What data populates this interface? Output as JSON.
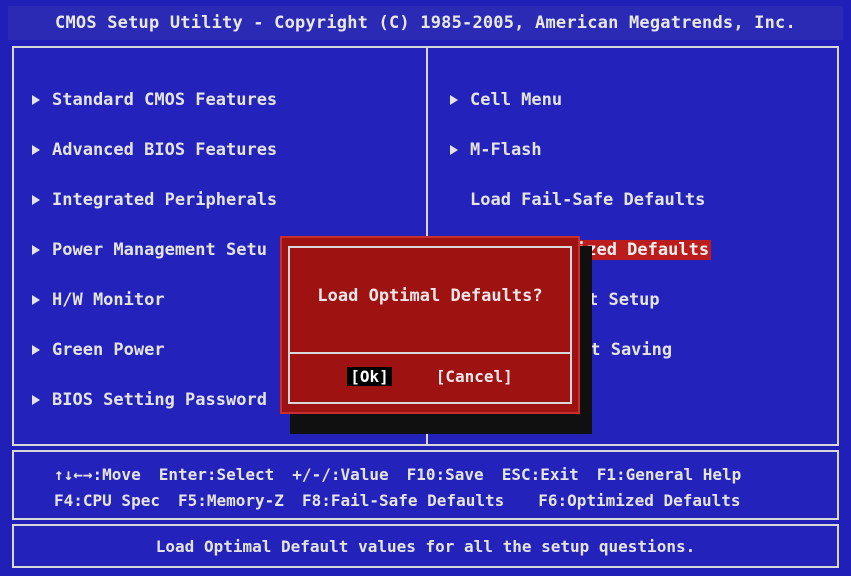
{
  "title": "CMOS Setup Utility - Copyright (C) 1985-2005, American Megatrends, Inc.",
  "left_menu": [
    {
      "label": "Standard CMOS Features"
    },
    {
      "label": "Advanced BIOS Features"
    },
    {
      "label": "Integrated Peripherals"
    },
    {
      "label": "Power Management Setu"
    },
    {
      "label": "H/W Monitor"
    },
    {
      "label": "Green Power"
    },
    {
      "label": "BIOS Setting Password"
    }
  ],
  "right_menu": [
    {
      "label": "Cell Menu"
    },
    {
      "label": "M-Flash"
    },
    {
      "label": "Load Fail-Safe Defaults"
    },
    {
      "label": "ized Defaults"
    },
    {
      "label": "t Setup"
    },
    {
      "label": "ut Saving"
    }
  ],
  "help": {
    "line1": [
      "↑↓←→:Move",
      "Enter:Select",
      "+/-/:Value",
      "F10:Save",
      "ESC:Exit",
      "F1:General Help"
    ],
    "line2": [
      "F4:CPU Spec",
      "F5:Memory-Z",
      "F8:Fail-Safe Defaults",
      "F6:Optimized Defaults"
    ]
  },
  "status": "Load Optimal Default values for all the setup questions.",
  "dialog": {
    "message": "Load Optimal Defaults?",
    "ok_label": "[Ok]",
    "cancel_label": "[Cancel]"
  },
  "colors": {
    "background": "#2020b8",
    "highlight": "#bb1c1c",
    "dialog": "#9e1212",
    "text": "#e4e4e4"
  }
}
